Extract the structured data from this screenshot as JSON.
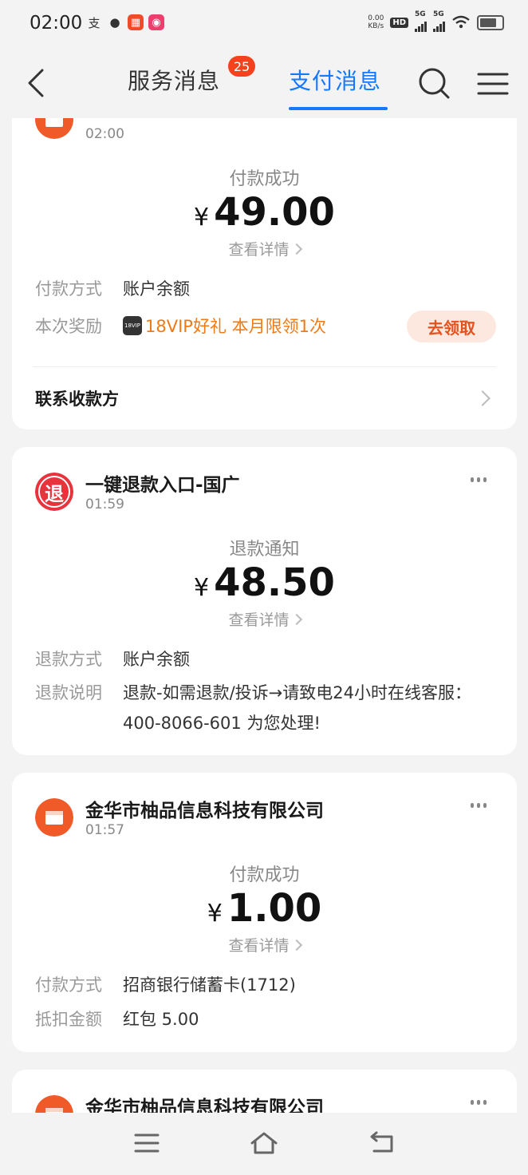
{
  "status_bar": {
    "time": "02:00",
    "net_speed_top": "0.00",
    "net_speed_bottom": "KB/s",
    "hd": "HD",
    "signal1": "5G",
    "signal2": "5G"
  },
  "header": {
    "tab_service": "服务消息",
    "badge": "25",
    "tab_pay": "支付消息"
  },
  "card1": {
    "time": "02:00",
    "status": "付款成功",
    "currency": "¥",
    "amount": "49.00",
    "detail": "查看详情",
    "row1_key": "付款方式",
    "row1_val": "账户余额",
    "row2_key": "本次奖励",
    "vip_tag": "18VIP",
    "row2_val": "18VIP好礼 本月限领1次",
    "claim": "去领取",
    "contact": "联系收款方"
  },
  "card2": {
    "name": "一键退款入口-国广",
    "icon_text": "退",
    "time": "01:59",
    "status": "退款通知",
    "currency": "¥",
    "amount": "48.50",
    "detail": "查看详情",
    "row1_key": "退款方式",
    "row1_val": "账户余额",
    "row2_key": "退款说明",
    "row2_val": "退款-如需退款/投诉→请致电24小时在线客服：400-8066-601 为您处理!"
  },
  "card3": {
    "name": "金华市柚品信息科技有限公司",
    "time": "01:57",
    "status": "付款成功",
    "currency": "¥",
    "amount": "1.00",
    "detail": "查看详情",
    "row1_key": "付款方式",
    "row1_val": "招商银行储蓄卡(1712)",
    "row2_key": "抵扣金额",
    "row2_val": "红包 5.00"
  },
  "card4": {
    "name": "金华市柚品信息科技有限公司"
  },
  "colors": {
    "accent": "#1677ff",
    "badge": "#f5421e",
    "merchant": "#f05a28",
    "refund": "#e8323c",
    "reward": "#f07a16"
  }
}
